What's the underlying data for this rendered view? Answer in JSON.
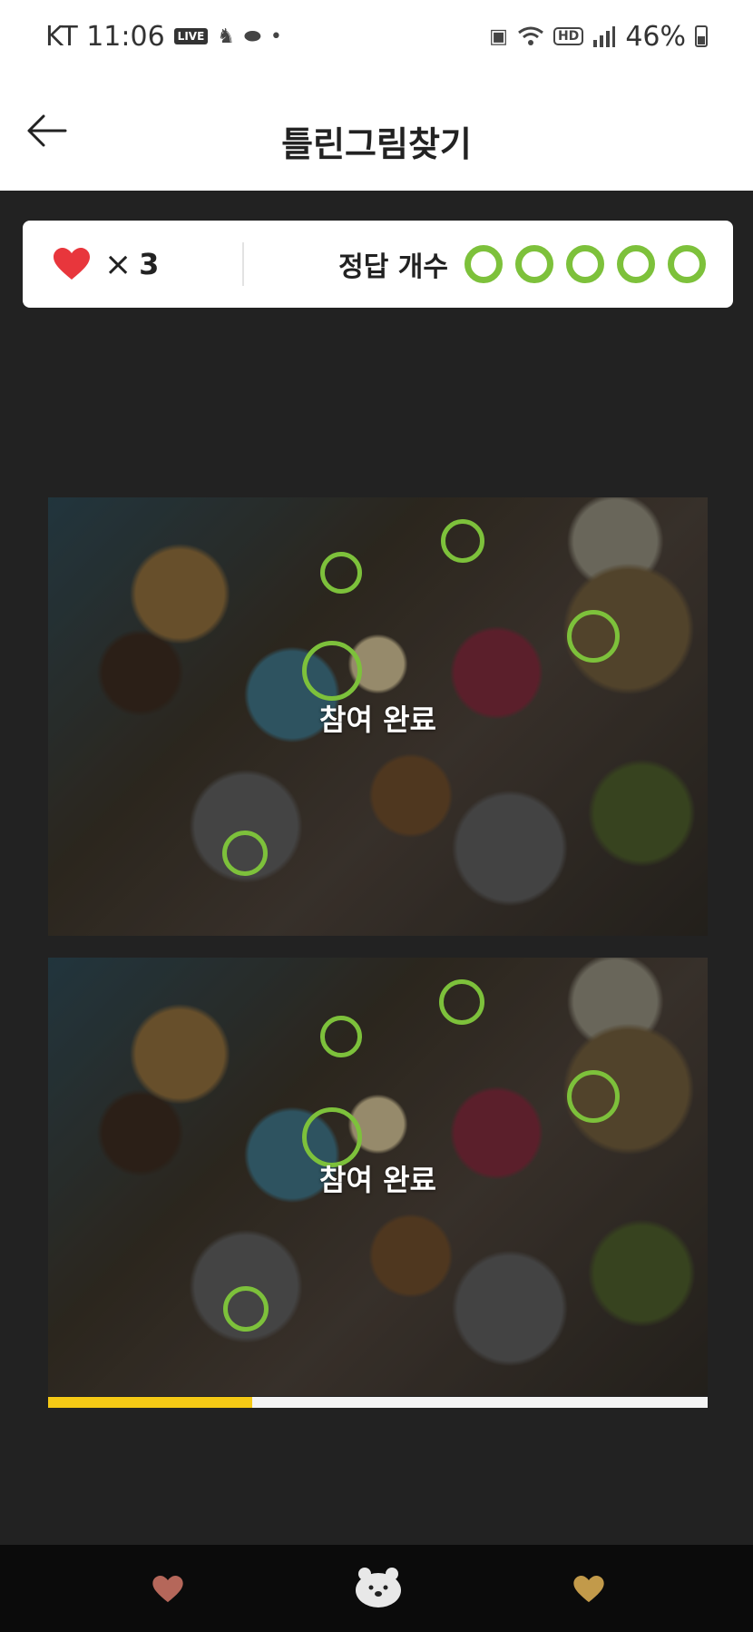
{
  "status_bar": {
    "carrier_time": "KT 11:06",
    "live_badge": "LIVE",
    "dot": "•",
    "hd_badge": "HD",
    "battery": "46%"
  },
  "header": {
    "title": "틀린그림찾기"
  },
  "score": {
    "times_symbol": "×",
    "lives": "3",
    "answers_label": "정답 개수",
    "answers_found": 5,
    "answers_total": 5
  },
  "photos": {
    "top_status": "참여 완료",
    "bottom_status": "참여 완료"
  },
  "progress": {
    "fraction": 0.31
  },
  "colors": {
    "accent_green": "#7dc13b",
    "heart_red": "#e8363c",
    "progress_yellow": "#f5c915",
    "nav_heart_left": "#b5675a",
    "nav_heart_right": "#c29a4a"
  },
  "icons": {
    "back": "back-arrow-icon",
    "heart": "heart-icon",
    "bear": "bear-icon"
  }
}
